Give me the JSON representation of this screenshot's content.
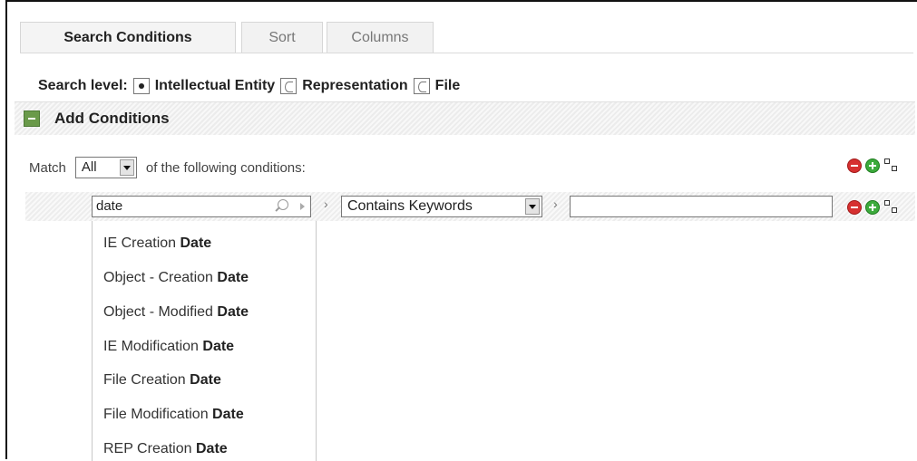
{
  "tabs": [
    {
      "label": "Search Conditions",
      "active": true
    },
    {
      "label": "Sort",
      "active": false
    },
    {
      "label": "Columns",
      "active": false
    }
  ],
  "search_level": {
    "label": "Search level:",
    "options": [
      {
        "label": "Intellectual Entity",
        "selected": true
      },
      {
        "label": "Representation",
        "selected": false
      },
      {
        "label": "File",
        "selected": false
      }
    ]
  },
  "add_conditions": {
    "label": "Add Conditions"
  },
  "match": {
    "prefix": "Match",
    "selected": "All",
    "suffix": "of the following conditions:"
  },
  "condition": {
    "field_value": "date",
    "operator": "Contains Keywords",
    "value": ""
  },
  "suggestions": [
    {
      "prefix": "IE Creation ",
      "match": "Date"
    },
    {
      "prefix": "Object - Creation ",
      "match": "Date"
    },
    {
      "prefix": "Object - Modified ",
      "match": "Date"
    },
    {
      "prefix": "IE Modification ",
      "match": "Date"
    },
    {
      "prefix": "File Creation ",
      "match": "Date"
    },
    {
      "prefix": "File Modification ",
      "match": "Date"
    },
    {
      "prefix": "REP Creation ",
      "match": "Date"
    }
  ],
  "colors": {
    "remove": "#d63030",
    "add": "#3caa3c",
    "collapse": "#6a9a4a"
  }
}
